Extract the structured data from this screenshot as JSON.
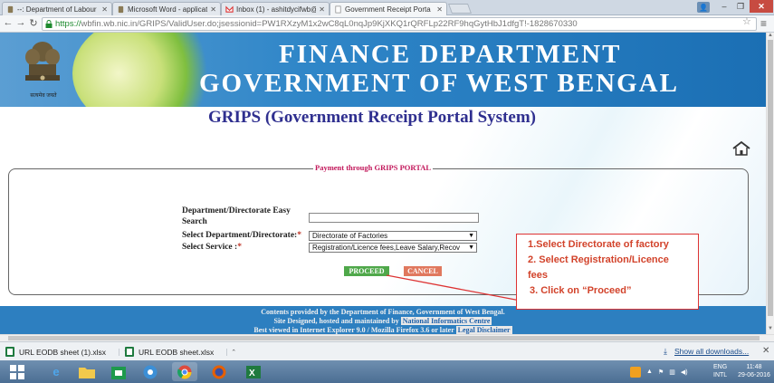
{
  "browser": {
    "tabs": [
      {
        "label": "--: Department of Labour",
        "favicon": "labour-emblem-icon"
      },
      {
        "label": "Microsoft Word - applicat",
        "favicon": "word-icon"
      },
      {
        "label": "Inbox (1) - ashitdycifwb@",
        "favicon": "gmail-icon"
      },
      {
        "label": "Government Receipt Porta",
        "favicon": "page-icon"
      }
    ],
    "url_scheme": "https://",
    "url_rest": "wbfin.wb.nic.in/GRIPS/ValidUser.do;jsessionid=PW1RXzyM1x2wC8qL0nqJp9KjXKQ1rQRFLp22RF9hqGytHbJ1dfgT!-1828670330"
  },
  "header": {
    "title_line1": "FINANCE DEPARTMENT",
    "title_line2": "GOVERNMENT OF WEST BENGAL",
    "emblem_motto": "सत्यमेव जयते"
  },
  "page": {
    "portal_title": "GRIPS (Government Receipt Portal System)",
    "fieldset_legend": "Payment through GRIPS PORTAL",
    "labels": {
      "easy_search_line1": "Department/Directorate Easy",
      "easy_search_line2": "Search",
      "select_department": "Select Department/Directorate:",
      "select_service": "Select Service :",
      "required_mark": "*"
    },
    "easy_search_value": "",
    "department_selected": "Directorate of Factories",
    "service_selected": "Registration/Licence fees,Leave Salary,Recov",
    "proceed_label": "PROCEED",
    "cancel_label": "CANCEL"
  },
  "footer": {
    "line1": "Contents provided by the Department of Finance, Government of West Bengal.",
    "line2_prefix": "Site Designed, hosted and maintained by",
    "line2_link": "National Informatics Centre",
    "line3_prefix": "Best viewed in Internet Explorer 9.0 / Mozilla Firefox 3.6 or later",
    "line3_link": "Legal Disclaimer"
  },
  "annotation": {
    "line1": "1.Select Directorate of factory",
    "line2": "2. Select Registration/Licence",
    "line3": "fees",
    "line4": "3. Click on “Proceed”"
  },
  "downloads": {
    "items": [
      {
        "name": "URL EODB sheet (1).xlsx"
      },
      {
        "name": "URL EODB sheet.xlsx"
      }
    ],
    "show_all": "Show all downloads..."
  },
  "taskbar": {
    "apps": [
      "start-icon",
      "internet-explorer-icon",
      "file-explorer-icon",
      "store-icon",
      "chrome-canary-icon",
      "chrome-icon",
      "firefox-icon",
      "excel-icon"
    ],
    "lang_line1": "ENG",
    "lang_line2": "INTL",
    "time": "11:48",
    "date": "29-06-2016"
  },
  "colors": {
    "header_blue": "#2f86c8",
    "portal_title": "#2f2f8f",
    "legend_pink": "#c2185b",
    "proceed_green": "#4fa84a",
    "cancel_orange": "#e0785e",
    "annotation_red": "#d2432b"
  }
}
